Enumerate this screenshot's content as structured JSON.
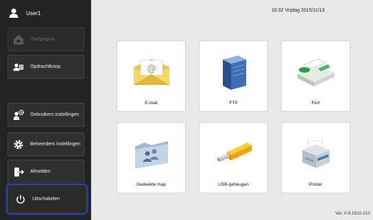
{
  "user": {
    "name": "User1"
  },
  "datetime": "16:32 Vrijdag 2015/11/13",
  "sidebar": {
    "home": "Startpagina",
    "jobs": "Opdrachtknop",
    "user_settings": "Gebruikers instellingen",
    "admin_settings": "Beheerders instellingen",
    "logout": "Afmelden",
    "shutdown": "Uitschakelen"
  },
  "tiles": {
    "email": "E-mail",
    "ftp": "FTP",
    "fax": "FAX",
    "shared": "Gedeelde map",
    "usb": "USB-geheugen",
    "printer": "Printer"
  },
  "version": "Ver. 0.9.1510.210",
  "colors": {
    "highlight": "#1d2fa8",
    "sidebar_bg": "#232323",
    "main_bg": "#e9e9e9"
  }
}
